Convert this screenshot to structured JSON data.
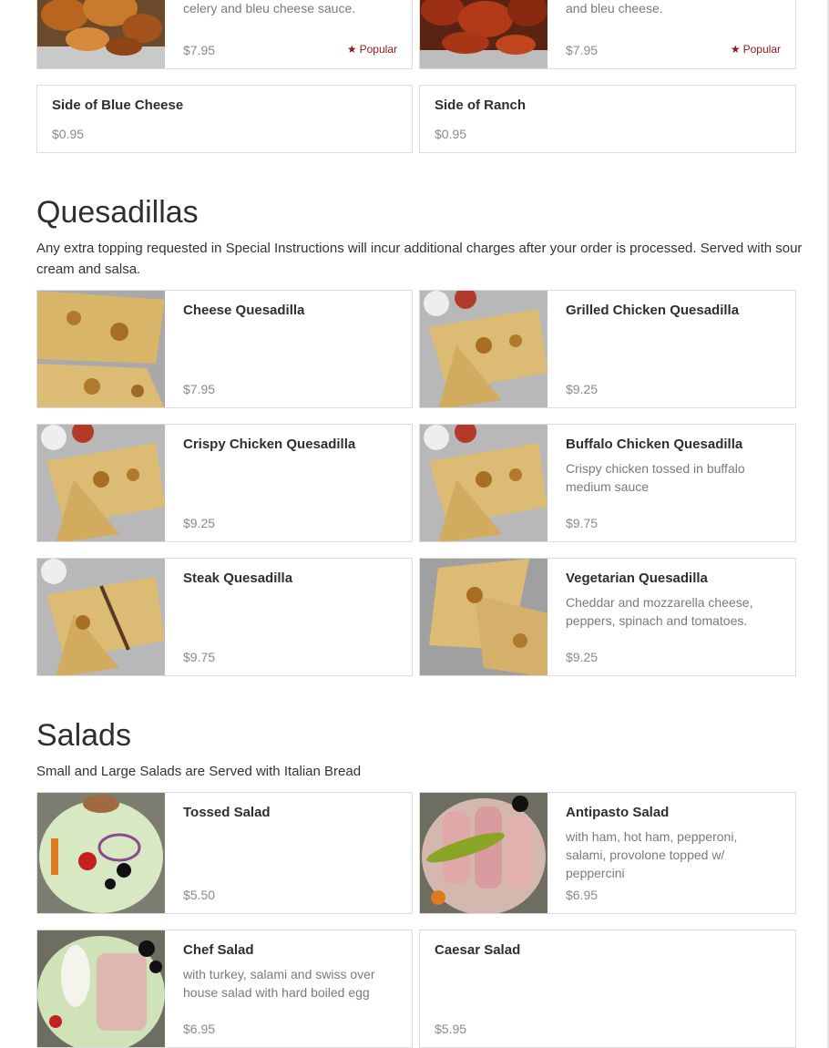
{
  "sections": {
    "wings": {
      "items": [
        {
          "desc_tail": "choice of sauce. Includes carrots, celery and bleu cheese sauce.",
          "price": "$7.95",
          "badge": "Popular"
        },
        {
          "desc_tail": "of sauce. Served with celery, carrots, and bleu cheese.",
          "price": "$7.95",
          "badge": "Popular"
        },
        {
          "name": "Side of Blue Cheese",
          "price": "$0.95"
        },
        {
          "name": "Side of Ranch",
          "price": "$0.95"
        }
      ]
    },
    "quesadillas": {
      "title": "Quesadillas",
      "description": "Any extra topping requested in Special Instructions will incur additional charges after your order is processed. Served with sour cream and salsa.",
      "items": [
        {
          "name": "Cheese Quesadilla",
          "desc": "",
          "price": "$7.95"
        },
        {
          "name": "Grilled Chicken Quesadilla",
          "desc": "",
          "price": "$9.25"
        },
        {
          "name": "Crispy Chicken Quesadilla",
          "desc": "",
          "price": "$9.25"
        },
        {
          "name": "Buffalo Chicken Quesadilla",
          "desc": "Crispy chicken tossed in buffalo medium sauce",
          "price": "$9.75"
        },
        {
          "name": "Steak Quesadilla",
          "desc": "",
          "price": "$9.75"
        },
        {
          "name": "Vegetarian Quesadilla",
          "desc": "Cheddar and mozzarella cheese, peppers, spinach and tomatoes.",
          "price": "$9.25"
        }
      ]
    },
    "salads": {
      "title": "Salads",
      "description": "Small and Large Salads are Served with Italian Bread",
      "items": [
        {
          "name": "Tossed Salad",
          "desc": "",
          "price": "$5.50"
        },
        {
          "name": "Antipasto Salad",
          "desc": "with ham, hot ham, pepperoni, salami, provolone topped w/ peppercini",
          "price": "$6.95"
        },
        {
          "name": "Chef Salad",
          "desc": "with turkey, salami and swiss over house salad with hard boiled egg",
          "price": "$6.95"
        },
        {
          "name": "Caesar Salad",
          "desc": "",
          "price": "$5.95"
        }
      ]
    }
  },
  "icons": {
    "popular": "star-icon"
  },
  "colors": {
    "popular": "#8b1a1a",
    "price": "#8a8a8a",
    "border": "#dcdcdc"
  }
}
